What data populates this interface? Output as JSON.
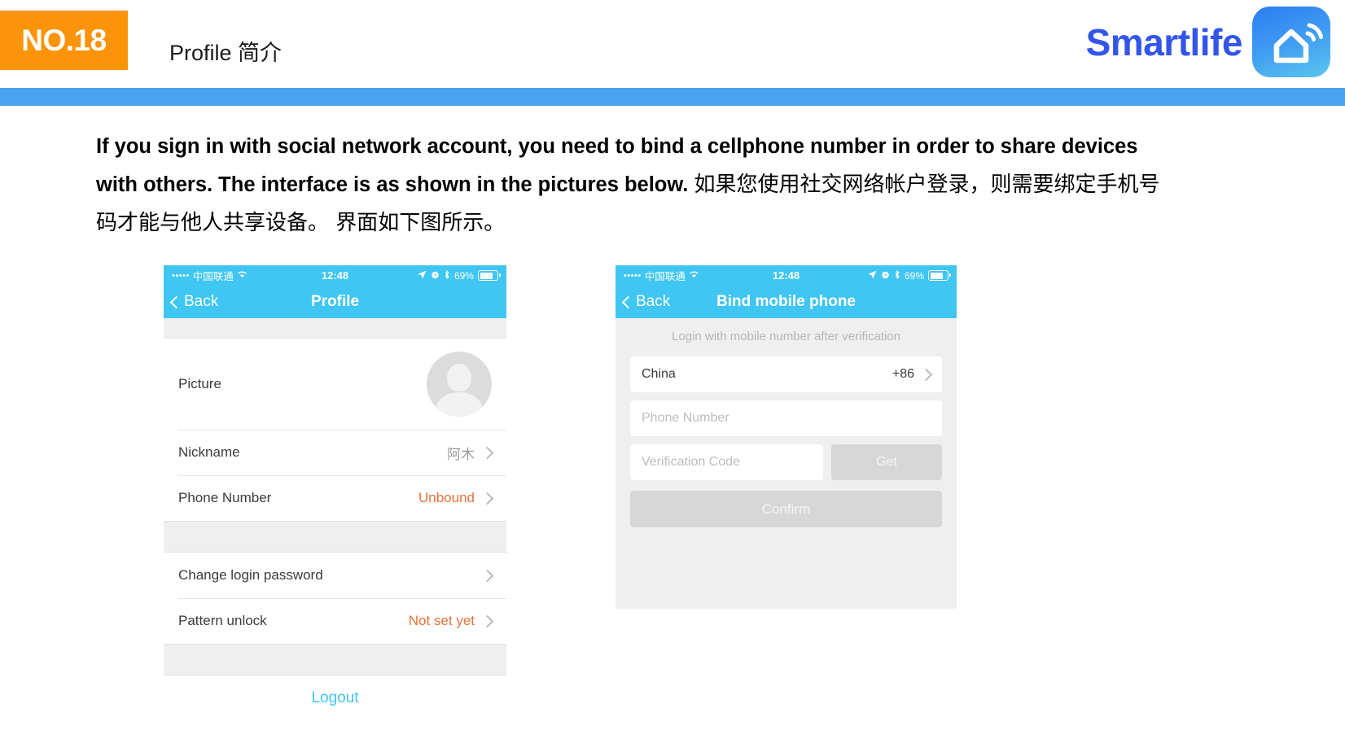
{
  "header": {
    "badge": "NO.18",
    "subtitle": "Profile 简介",
    "brand": "Smartlife",
    "brand_color": "#3355E8",
    "badge_color": "#FB9409",
    "bar_color": "#4AA3F0",
    "logo_icon": "smart-home-wifi-icon"
  },
  "body": {
    "english": "If you sign in with social network account, you need to bind a cellphone number in order to share devices with others. The interface is as shown in the pictures below.",
    "chinese": "如果您使用社交网络帐户登录，则需要绑定手机号码才能与他人共享设备。 界面如下图所示。"
  },
  "phone_left": {
    "status": {
      "signal_dots": "•••••",
      "carrier": "中国联通",
      "wifi_icon": "wifi-icon",
      "time": "12:48",
      "location_icon": "location-arrow-icon",
      "alarm_icon": "alarm-clock-icon",
      "bluetooth_icon": "bluetooth-icon",
      "battery_percent": "69%",
      "battery_icon": "battery-icon"
    },
    "nav": {
      "back_label": "Back",
      "back_icon": "chevron-left-icon",
      "title": "Profile"
    },
    "rows": [
      {
        "label": "Picture",
        "value": "",
        "kind": "avatar",
        "avatar_icon": "person-placeholder-icon"
      },
      {
        "label": "Nickname",
        "value": "阿木",
        "kind": "value",
        "value_color": "#9A9A9A"
      },
      {
        "label": "Phone Number",
        "value": "Unbound",
        "kind": "value",
        "value_color": "#E8703A"
      },
      {
        "label": "Change login password",
        "value": "",
        "kind": "value"
      },
      {
        "label": "Pattern unlock",
        "value": "Not set yet",
        "kind": "value",
        "value_color": "#E8703A"
      }
    ],
    "logout_label": "Logout",
    "logout_color": "#3FC6F2",
    "accent_color": "#3FC6F2"
  },
  "phone_right": {
    "status": {
      "signal_dots": "•••••",
      "carrier": "中国联通",
      "wifi_icon": "wifi-icon",
      "time": "12:48",
      "location_icon": "location-arrow-icon",
      "alarm_icon": "alarm-clock-icon",
      "bluetooth_icon": "bluetooth-icon",
      "battery_percent": "69%",
      "battery_icon": "battery-icon"
    },
    "nav": {
      "back_label": "Back",
      "back_icon": "chevron-left-icon",
      "title": "Bind mobile phone"
    },
    "hint": "Login with mobile number after verification",
    "country_label": "China",
    "country_code": "+86",
    "phone_placeholder": "Phone Number",
    "code_placeholder": "Verification Code",
    "get_label": "Get",
    "confirm_label": "Confirm"
  }
}
